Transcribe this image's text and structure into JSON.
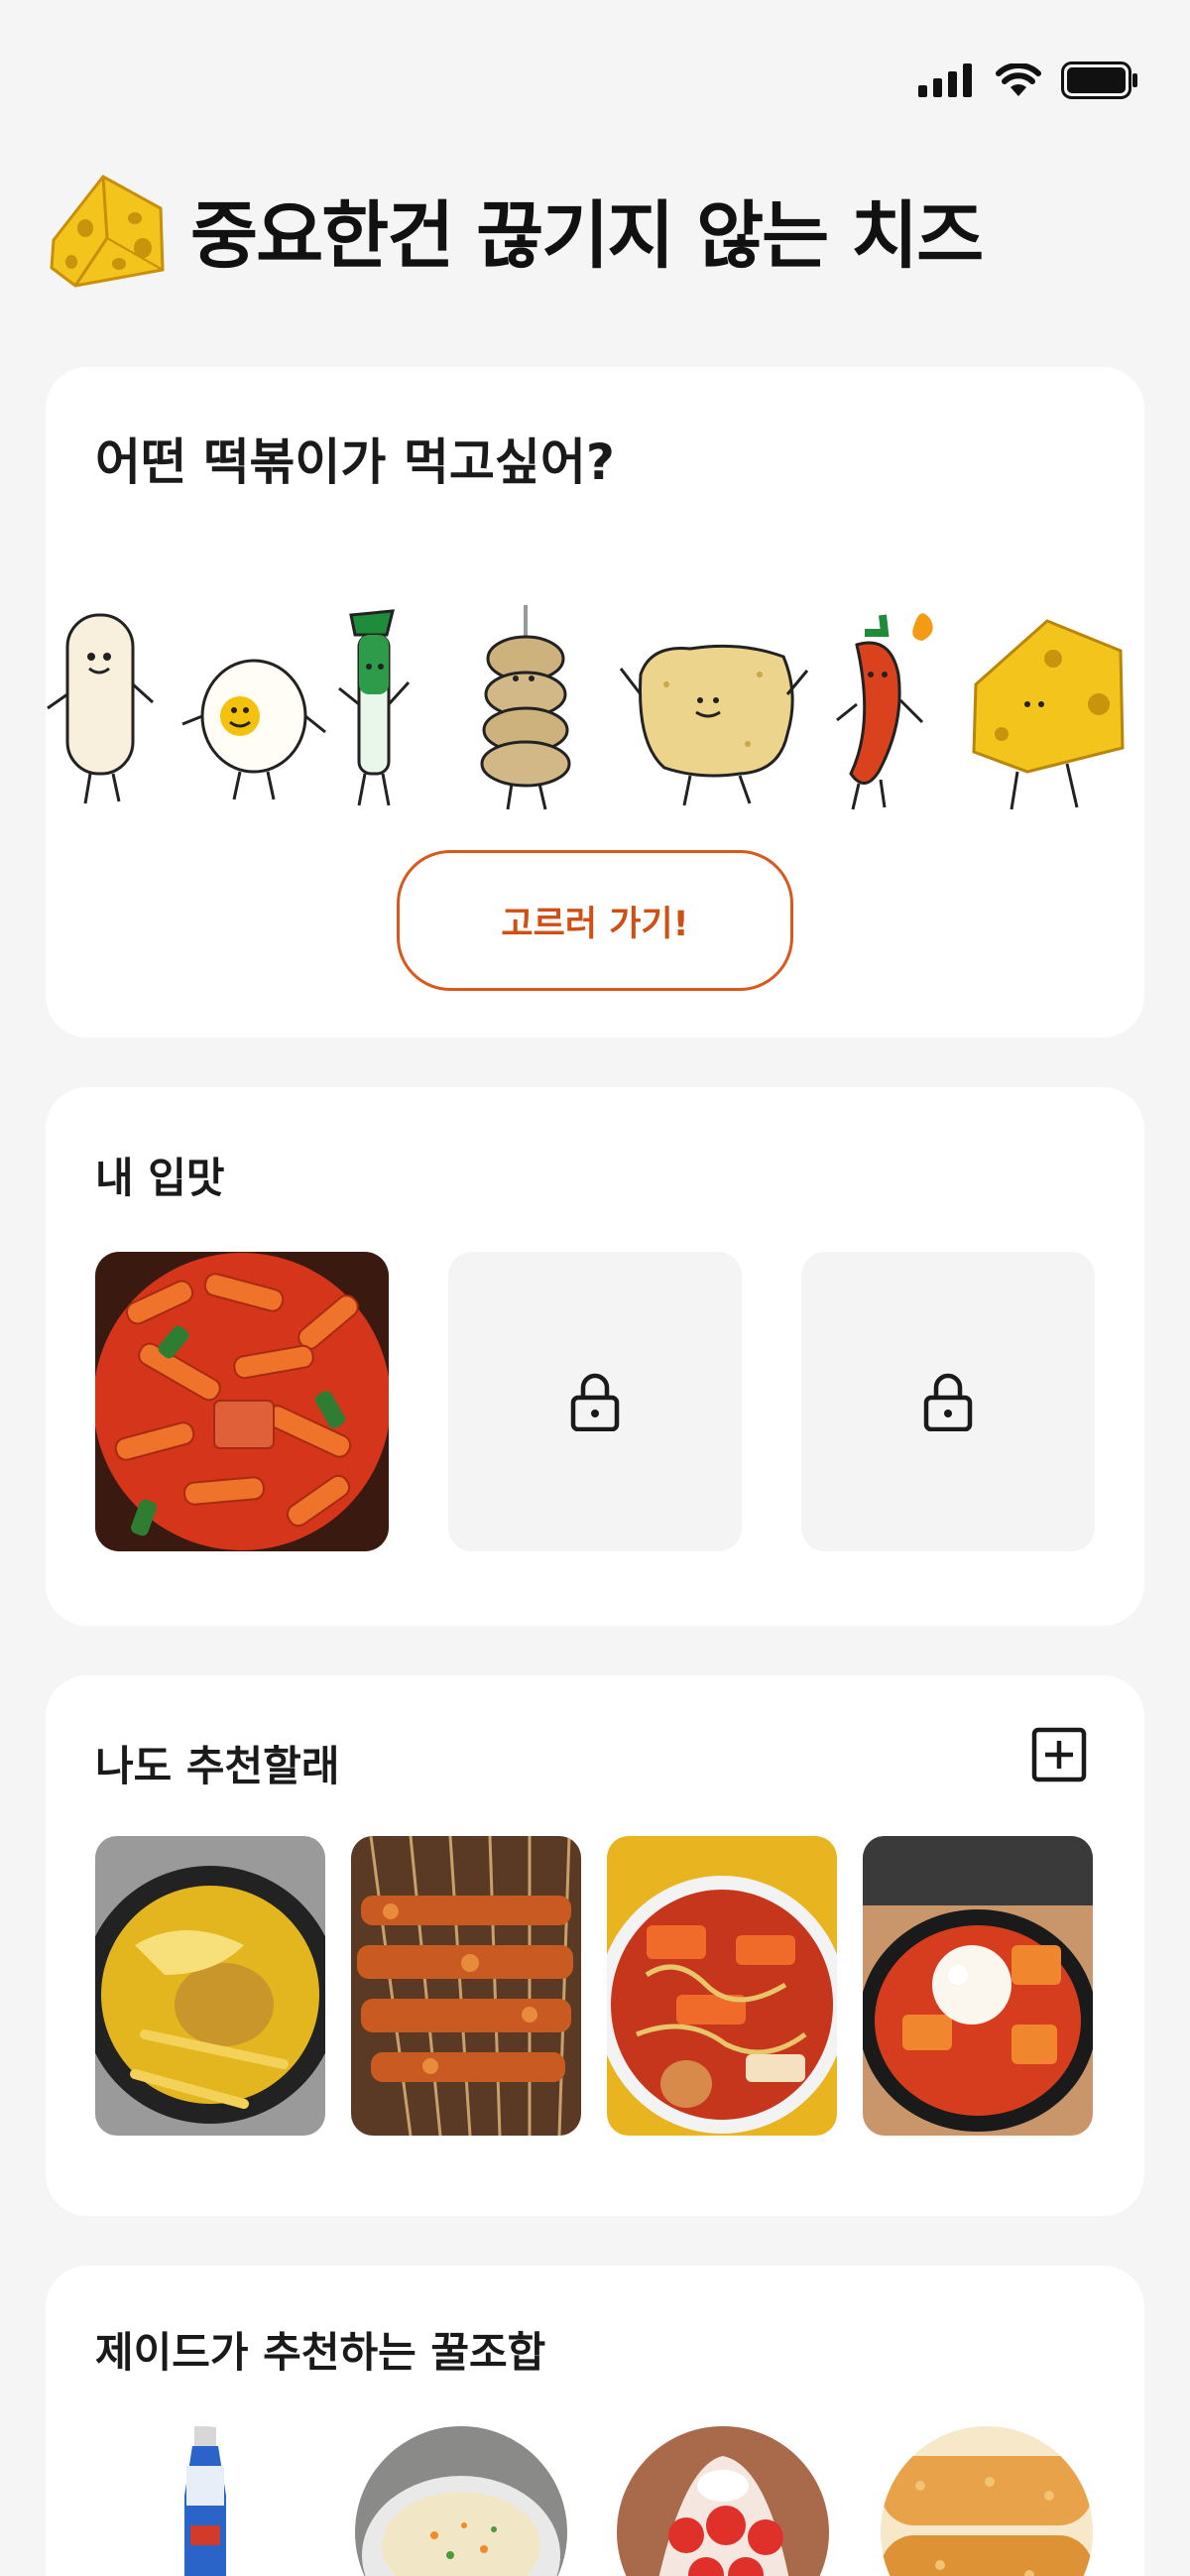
{
  "status_bar": {
    "icons": [
      "cellular-signal-icon",
      "wifi-icon",
      "battery-icon"
    ]
  },
  "header": {
    "logo_icon": "cheese-icon",
    "title": "중요한건 끊기지 않는 치즈"
  },
  "choose_card": {
    "question": "어떤 떡볶이가 먹고싶어?",
    "characters": [
      "rice-cake",
      "egg",
      "green-onion",
      "fish-cake-skewer",
      "fried-snack",
      "chili-pepper",
      "cheese"
    ],
    "cta_label": "고르러 가기!"
  },
  "my_taste": {
    "title": "내 입맛",
    "slots": [
      {
        "state": "unlocked",
        "image": "red tteokbokki"
      },
      {
        "state": "locked",
        "icon": "lock-icon"
      },
      {
        "state": "locked",
        "icon": "lock-icon"
      }
    ]
  },
  "recommend": {
    "title": "나도 추천할래",
    "add_icon": "plus-square-icon",
    "images": [
      "cheese curry tteokbokki",
      "tteok skewers",
      "rabokki with egg",
      "tteokbokki with ice cream"
    ]
  },
  "jade_combo": {
    "title": "제이드가 추천하는 꿀조합",
    "images": [
      "soda bottle",
      "rice porridge",
      "strawberry bingsu",
      "fried cutlet"
    ]
  },
  "colors": {
    "accent": "#d9581e",
    "background": "#f5f5f5",
    "card": "#ffffff",
    "cheese": "#f2c218"
  }
}
